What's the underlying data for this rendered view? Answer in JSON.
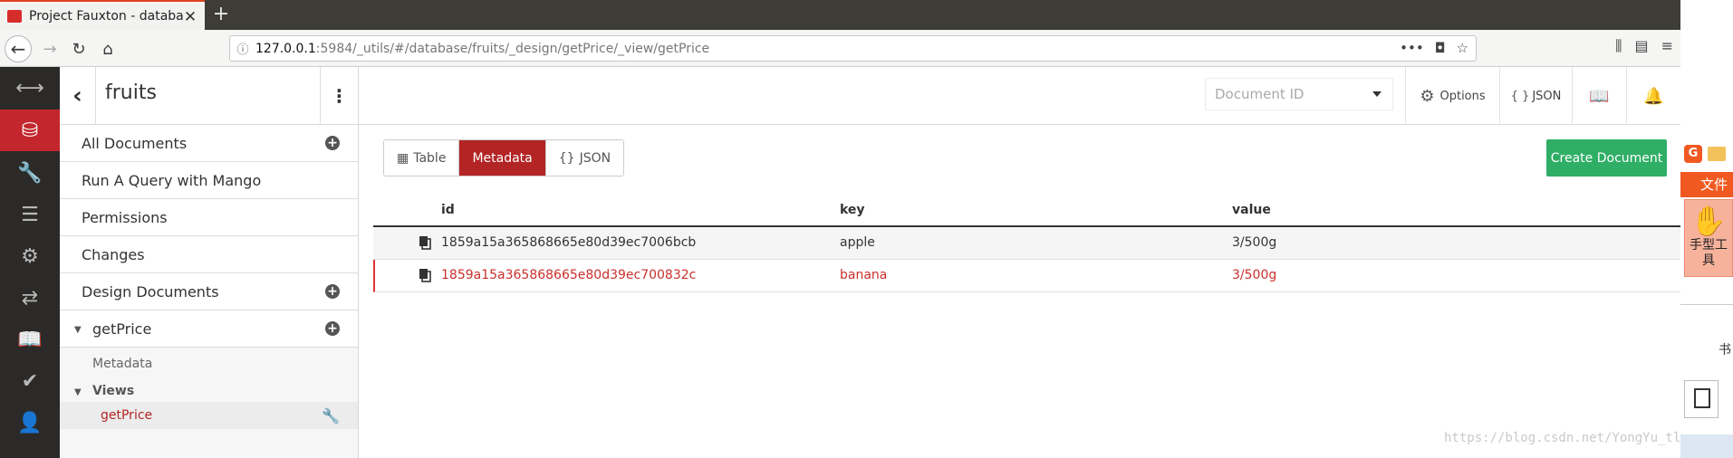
{
  "browser": {
    "tab_title": "Project Fauxton - databa",
    "url_host": "127.0.0.1",
    "url_path": ":5984/_utils/#/database/fruits/_design/getPrice/_view/getPrice"
  },
  "sidebar": {
    "db_name": "fruits",
    "items": [
      "All Documents",
      "Run A Query with Mango",
      "Permissions",
      "Changes",
      "Design Documents"
    ],
    "design_doc": "getPrice",
    "metadata_label": "Metadata",
    "views_label": "Views",
    "view_name": "getPrice"
  },
  "header": {
    "docid_placeholder": "Document ID",
    "options_label": "Options",
    "json_label": "JSON"
  },
  "toolbar": {
    "tabs": [
      "Table",
      "Metadata",
      "JSON"
    ],
    "active_tab": "Metadata",
    "create_label": "Create Document",
    "create_color": "#2fae66"
  },
  "table": {
    "columns": [
      "id",
      "key",
      "value"
    ],
    "rows": [
      {
        "id": "1859a15a365868665e80d39ec7006bcb",
        "key": "apple",
        "value": "3/500g"
      },
      {
        "id": "1859a15a365868665e80d39ec700832c",
        "key": "banana",
        "value": "3/500g"
      }
    ]
  },
  "overlay": {
    "file_label": "文件",
    "hand_tool": "手型工具",
    "book_char": "书"
  },
  "watermark": "https://blog.csdn.net/YongYu_tl",
  "colors": {
    "accent": "#c3262d",
    "sidebar_dark": "#2c2a28"
  }
}
